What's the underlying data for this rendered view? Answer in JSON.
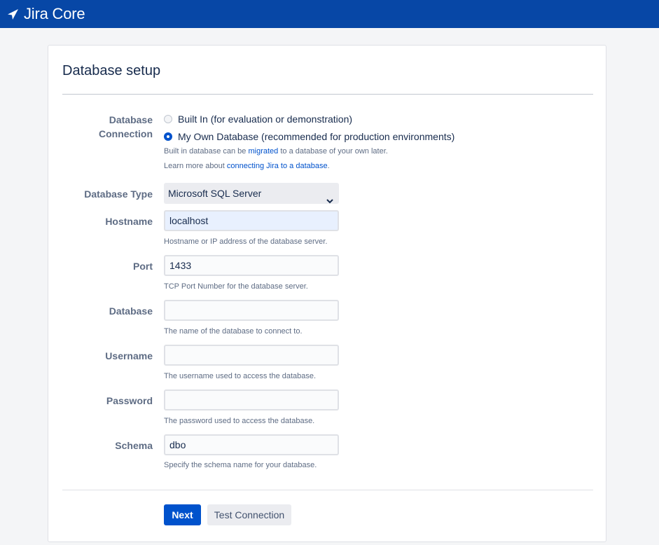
{
  "app": {
    "title": "Jira Core"
  },
  "page": {
    "title": "Database setup"
  },
  "connection": {
    "label_line1": "Database",
    "label_line2": "Connection",
    "options": [
      {
        "label": "Built In (for evaluation or demonstration)",
        "selected": false
      },
      {
        "label": "My Own Database (recommended for production environments)",
        "selected": true
      }
    ],
    "help1_pre": "Built in database can be ",
    "help1_link": "migrated",
    "help1_post": " to a database of your own later.",
    "help2_pre": "Learn more about ",
    "help2_link": "connecting Jira to a database",
    "help2_post": "."
  },
  "db_type": {
    "label": "Database Type",
    "value": "Microsoft SQL Server"
  },
  "hostname": {
    "label": "Hostname",
    "value": "localhost",
    "help": "Hostname or IP address of the database server."
  },
  "port": {
    "label": "Port",
    "value": "1433",
    "help": "TCP Port Number for the database server."
  },
  "database": {
    "label": "Database",
    "value": "",
    "help": "The name of the database to connect to."
  },
  "username": {
    "label": "Username",
    "value": "",
    "help": "The username used to access the database."
  },
  "password": {
    "label": "Password",
    "value": "",
    "help": "The password used to access the database."
  },
  "schema": {
    "label": "Schema",
    "value": "dbo",
    "help": "Specify the schema name for your database."
  },
  "actions": {
    "next": "Next",
    "test": "Test Connection"
  },
  "colors": {
    "header": "#0747a6",
    "primary": "#0052cc",
    "link": "#0052cc"
  },
  "icons": {
    "logo": "jira-logo-icon",
    "select": "chevron-down-icon"
  }
}
